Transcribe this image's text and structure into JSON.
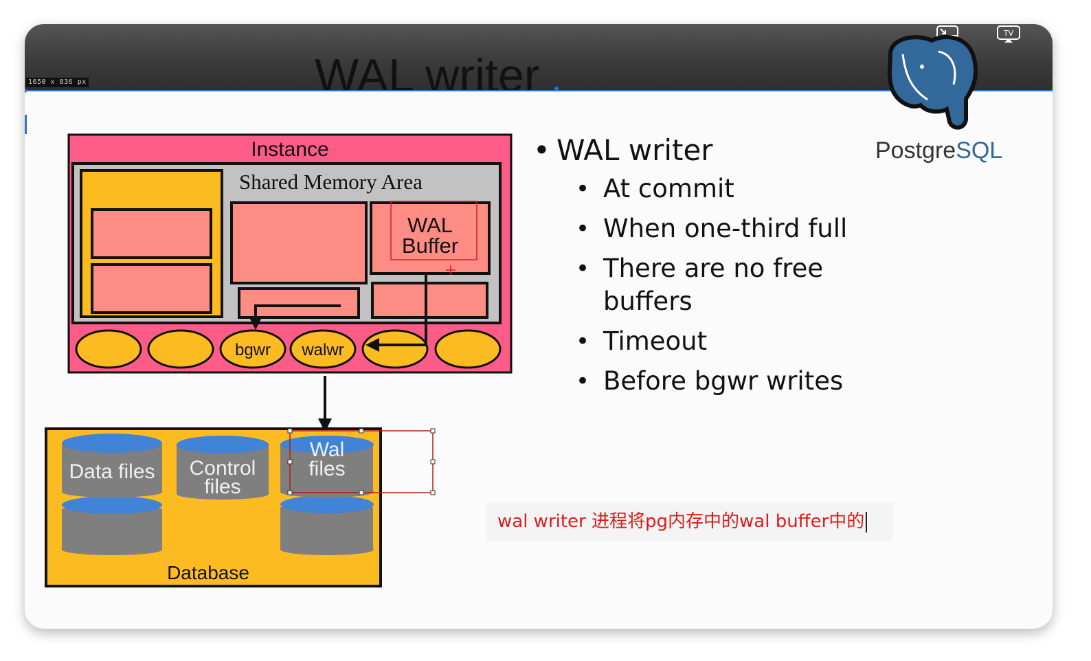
{
  "screen": {
    "dimension_badge": "1650 x 836  px",
    "title": "WAL writer",
    "icons": [
      "exit-fullscreen-icon",
      "tv-airplay-icon"
    ]
  },
  "logo": {
    "text_a": "Postgre",
    "text_b": "SQL"
  },
  "diagram": {
    "instance_label": "Instance",
    "shared_memory_label": "Shared Memory Area",
    "wal_buffer_line1": "WAL",
    "wal_buffer_line2": "Buffer",
    "processes": [
      "",
      "",
      "bgwr",
      "walwr",
      "",
      ""
    ],
    "database_label": "Database",
    "data_files": "Data files",
    "control_files_line1": "Control",
    "control_files_line2": "files",
    "wal_files_line1": "Wal",
    "wal_files_line2": "files"
  },
  "bullets": {
    "main": "WAL writer",
    "items": [
      "At commit",
      "When one-third full",
      "There are no free buffers",
      "Timeout",
      "Before bgwr writes"
    ]
  },
  "note": {
    "text": "wal writer 进程将pg内存中的wal buffer中的"
  },
  "colors": {
    "instance_fill": "#fd5c88",
    "memory_fill": "#c2c2c2",
    "block_fill": "#fc8c84",
    "amber_fill": "#fdbb22",
    "disk_grey": "#7f7f7f",
    "disk_blue": "#4183d6",
    "note_red": "#e01a1a",
    "selection_blue": "#2f72d8"
  }
}
